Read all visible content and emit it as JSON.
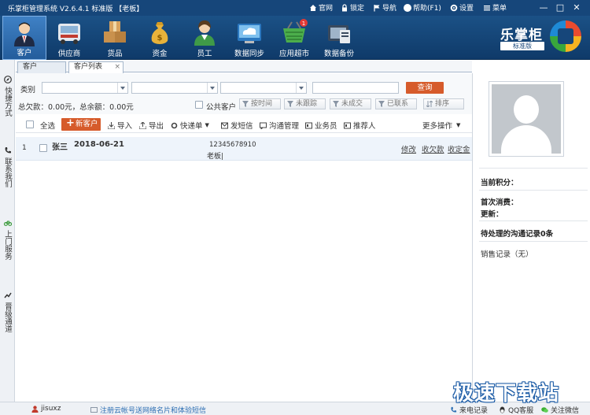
{
  "window": {
    "title": "乐掌柜管理系统 V2.6.4.1 标准版 【老板】",
    "links": {
      "official": "官网",
      "lock": "锁定",
      "nav": "导航",
      "help": "帮助(F1)",
      "settings": "设置",
      "menu": "菜单"
    },
    "controls": {
      "minimize": "—",
      "maximize": "□",
      "close": "✕"
    }
  },
  "toolbar": {
    "items": [
      {
        "label": "客户",
        "active": true
      },
      {
        "label": "供应商"
      },
      {
        "label": "货品"
      },
      {
        "label": "资金"
      },
      {
        "label": "员工"
      },
      {
        "label": "数据同步"
      },
      {
        "label": "应用超市",
        "badge": "1"
      },
      {
        "label": "数据备份"
      }
    ],
    "brand_name": "乐掌柜",
    "brand_edition": "标准版"
  },
  "leftbar": {
    "items": [
      {
        "label": "快捷方式",
        "icon": "compass-icon"
      },
      {
        "label": "联系我们",
        "icon": "phone-icon"
      },
      {
        "label": "上门服务",
        "icon": "bike-icon"
      },
      {
        "label": "晋级通道",
        "icon": "chart-icon"
      }
    ]
  },
  "tabs": [
    {
      "label": "客户"
    },
    {
      "label": "客户列表",
      "active": true,
      "close": "×"
    }
  ],
  "filter": {
    "category_label": "类别",
    "query_button": "查询",
    "summary": "总欠款：0.00元，总余额：0.00元",
    "public_customer": "公共客户",
    "buttons": [
      "按时间",
      "未跟踪",
      "未成交",
      "已联系",
      "排序"
    ]
  },
  "actions": {
    "select_all": "全选",
    "new_customer": "新客户",
    "import": "导入",
    "export": "导出",
    "quick_order": "快递单",
    "sms": "发短信",
    "comm": "沟通管理",
    "staff": "业务员",
    "referrer": "推荐人",
    "more": "更多操作"
  },
  "rows": [
    {
      "index": "1",
      "name": "张三",
      "date": "2018-06-21",
      "phone": "12345678910",
      "role": "老板|",
      "edit": "修改",
      "collect": "收欠款",
      "collect_all": "收定金"
    }
  ],
  "detail": {
    "points": "当前积分：",
    "first_consume": "首次消费：",
    "updated": "更新：",
    "pending_comm": "待处理的沟通记录0条",
    "sales_record": "销售记录（无）"
  },
  "statusbar": {
    "user": "jisuxz",
    "promo": "注册云帐号送网络名片和体验短信",
    "call_log": "来电记录",
    "qq": "QQ客服",
    "wechat": "关注微信"
  },
  "watermark": "极速下载站",
  "colors": {
    "titlebar": "#16467a",
    "toolbar": "#1b5186",
    "accent": "#d65b2b"
  }
}
